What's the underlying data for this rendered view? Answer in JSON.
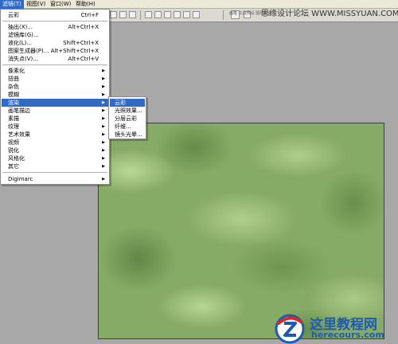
{
  "menubar": {
    "items": [
      {
        "label": "滤镜(T)",
        "active": true
      },
      {
        "label": "视图(V)",
        "active": false
      },
      {
        "label": "窗口(W)",
        "active": false
      },
      {
        "label": "帮助(H)",
        "active": false
      }
    ]
  },
  "toolbar": {
    "hint_text": "画笔   工具预设   图层复合"
  },
  "watermark": "思缘设计论坛  WWW.MISSYUAN.COM",
  "filter_menu": {
    "top_items": [
      {
        "label": "云彩",
        "shortcut": "Ctrl+F"
      }
    ],
    "group2": [
      {
        "label": "抽出(X)...",
        "shortcut": "Alt+Ctrl+X"
      },
      {
        "label": "滤镜库(G)...",
        "shortcut": ""
      },
      {
        "label": "液化(L)...",
        "shortcut": "Shift+Ctrl+X"
      },
      {
        "label": "图案生成器(P)...",
        "shortcut": "Alt+Shift+Ctrl+X"
      },
      {
        "label": "消失点(V)...",
        "shortcut": "Alt+Ctrl+V"
      }
    ],
    "submenus": [
      {
        "label": "像素化",
        "highlighted": false
      },
      {
        "label": "扭曲",
        "highlighted": false
      },
      {
        "label": "杂色",
        "highlighted": false
      },
      {
        "label": "模糊",
        "highlighted": false
      },
      {
        "label": "渲染",
        "highlighted": true
      },
      {
        "label": "画笔描边",
        "highlighted": false
      },
      {
        "label": "素描",
        "highlighted": false
      },
      {
        "label": "纹理",
        "highlighted": false
      },
      {
        "label": "艺术效果",
        "highlighted": false
      },
      {
        "label": "视频",
        "highlighted": false
      },
      {
        "label": "锐化",
        "highlighted": false
      },
      {
        "label": "风格化",
        "highlighted": false
      },
      {
        "label": "其它",
        "highlighted": false
      }
    ],
    "bottom_items": [
      {
        "label": "Digimarc",
        "submenu": true
      }
    ]
  },
  "render_submenu": {
    "items": [
      {
        "label": "云彩",
        "highlighted": true
      },
      {
        "label": "光照效果...",
        "highlighted": false
      },
      {
        "label": "分层云彩",
        "highlighted": false
      },
      {
        "label": "纤维...",
        "highlighted": false
      },
      {
        "label": "镜头光晕...",
        "highlighted": false
      }
    ]
  },
  "logo": {
    "title": "这里教程网",
    "url": "herecours.com",
    "badge_letter": "Z"
  },
  "colors": {
    "menu_highlight": "#316ac5",
    "canvas_green": "#86ab66",
    "logo_blue": "#1e5bb0",
    "logo_red": "#d9262b"
  }
}
